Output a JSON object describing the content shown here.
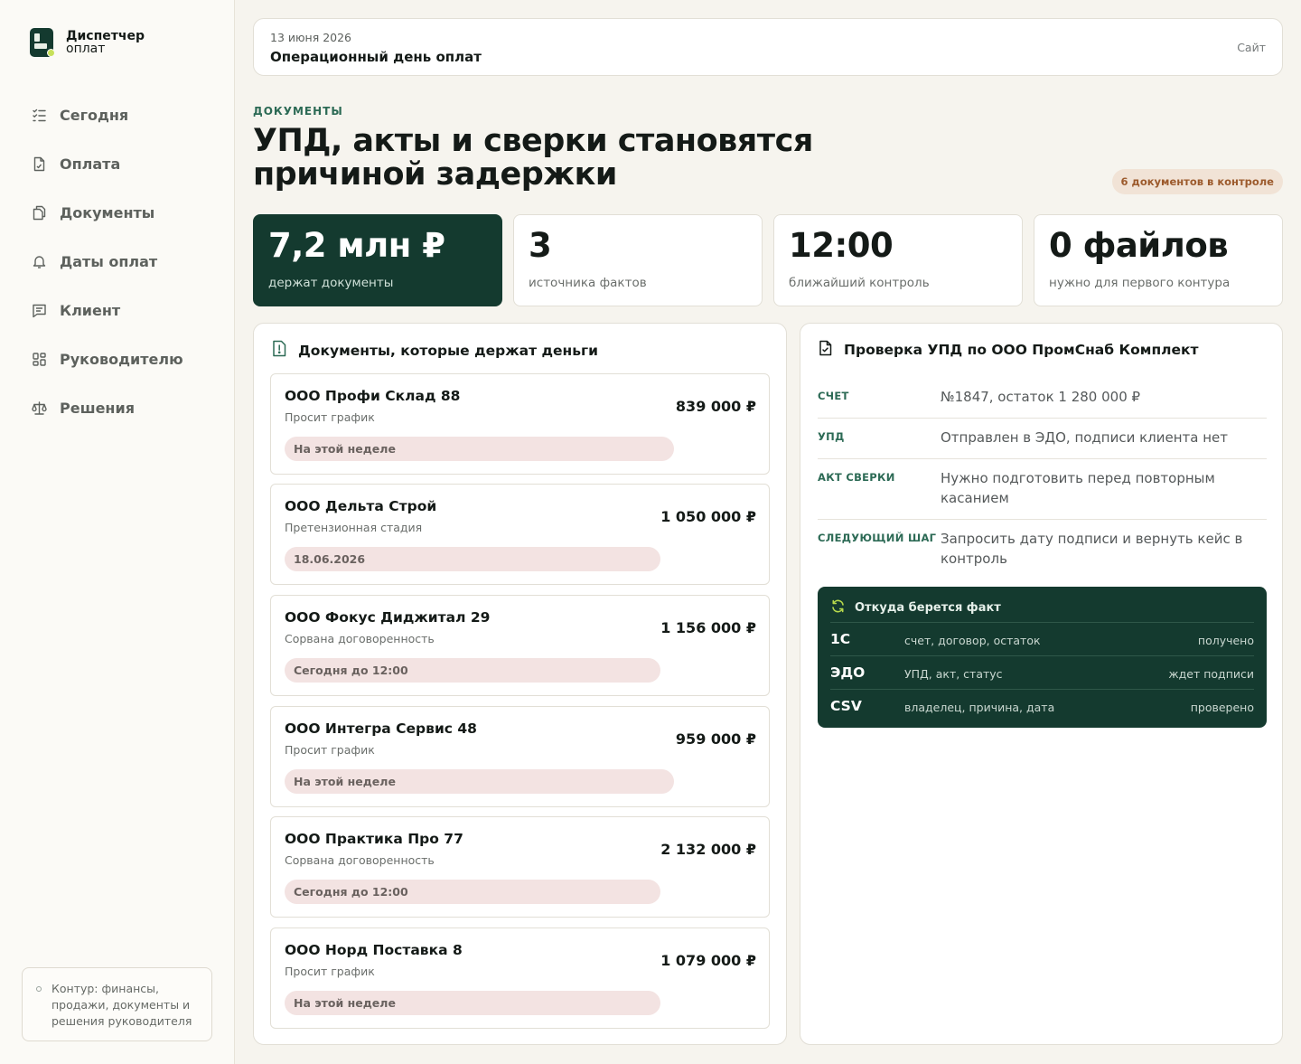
{
  "brand": {
    "title": "Диспетчер",
    "subtitle": "оплат"
  },
  "nav": [
    {
      "label": "Сегодня",
      "icon": "checklist-icon"
    },
    {
      "label": "Оплата",
      "icon": "document-icon"
    },
    {
      "label": "Документы",
      "icon": "documents-icon"
    },
    {
      "label": "Даты оплат",
      "icon": "bell-icon"
    },
    {
      "label": "Клиент",
      "icon": "message-icon"
    },
    {
      "label": "Руководителю",
      "icon": "dashboard-icon"
    },
    {
      "label": "Решения",
      "icon": "scales-icon"
    }
  ],
  "side_note": "Контур: финансы, продажи, документы и решения руководителя",
  "header": {
    "date": "13 июня 2026",
    "title": "Операционный день оплат",
    "site_link": "Сайт"
  },
  "section": {
    "eyebrow": "ДОКУМЕНТЫ",
    "title": "УПД, акты и сверки становятся причиной задержки",
    "badge": "6 документов в контроле"
  },
  "stats": [
    {
      "value": "7,2 млн ₽",
      "label": "держат документы"
    },
    {
      "value": "3",
      "label": "источника фактов"
    },
    {
      "value": "12:00",
      "label": "ближайший контроль"
    },
    {
      "value": "0 файлов",
      "label": "нужно для первого контура"
    }
  ],
  "documents_panel": {
    "title": "Документы, которые держат деньги",
    "items": [
      {
        "name": "ООО Профи Склад 88",
        "status": "Просит график",
        "amount": "839 000 ₽",
        "deadline": "На этой неделе"
      },
      {
        "name": "ООО Дельта Строй",
        "status": "Претензионная стадия",
        "amount": "1 050 000 ₽",
        "deadline": "18.06.2026"
      },
      {
        "name": "ООО Фокус Диджитал 29",
        "status": "Сорвана договоренность",
        "amount": "1 156 000 ₽",
        "deadline": "Сегодня до 12:00"
      },
      {
        "name": "ООО Интегра Сервис 48",
        "status": "Просит график",
        "amount": "959 000 ₽",
        "deadline": "На этой неделе"
      },
      {
        "name": "ООО Практика Про 77",
        "status": "Сорвана договоренность",
        "amount": "2 132 000 ₽",
        "deadline": "Сегодня до 12:00"
      },
      {
        "name": "ООО Норд Поставка 8",
        "status": "Просит график",
        "amount": "1 079 000 ₽",
        "deadline": "На этой неделе"
      }
    ]
  },
  "check_panel": {
    "title": "Проверка УПД по ООО ПромСнаб Комплект",
    "rows": [
      {
        "key": "СЧЕТ",
        "value": "№1847, остаток 1 280 000 ₽"
      },
      {
        "key": "УПД",
        "value": "Отправлен в ЭДО, подписи клиента нет"
      },
      {
        "key": "АКТ СВЕРКИ",
        "value": "Нужно подготовить перед повторным касанием"
      },
      {
        "key": "СЛЕДУЮЩИЙ ШАГ",
        "value": "Запросить дату подписи и вернуть кейс в контроль"
      }
    ],
    "facts": {
      "title": "Откуда берется факт",
      "rows": [
        {
          "source": "1С",
          "desc": "счет, договор, остаток",
          "status": "получено"
        },
        {
          "source": "ЭДО",
          "desc": "УПД, акт, статус",
          "status": "ждет подписи"
        },
        {
          "source": "CSV",
          "desc": "владелец, причина, дата",
          "status": "проверено"
        }
      ]
    }
  },
  "colors": {
    "accent_dark": "#143a2f",
    "accent_text": "#2c6a55",
    "tag_bg": "#f3e3e2",
    "badge_bg": "#f1e3d6",
    "badge_text": "#9c5a2c"
  }
}
